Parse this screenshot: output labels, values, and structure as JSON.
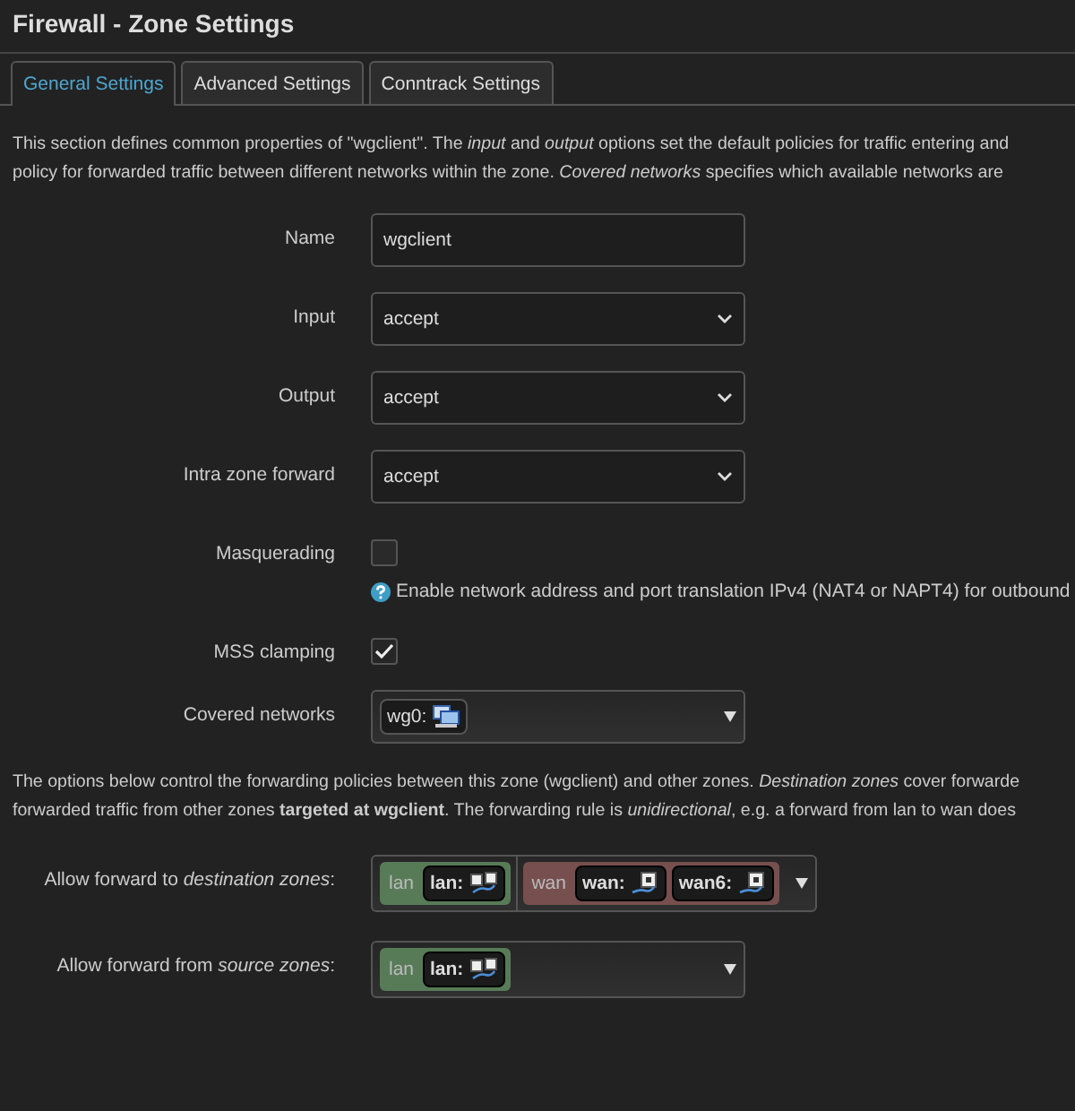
{
  "title": "Firewall - Zone Settings",
  "tabs": [
    {
      "label": "General Settings",
      "selected": true
    },
    {
      "label": "Advanced Settings",
      "selected": false
    },
    {
      "label": "Conntrack Settings",
      "selected": false
    }
  ],
  "intro": [
    "This section defines common properties of \"wgclient\". The *input* and *output* options set the default policies for traffic entering and",
    "policy for forwarded traffic between different networks within the zone. *Covered networks* specifies which available networks are"
  ],
  "fields": [
    {
      "kind": "text",
      "label": "Name",
      "value": "wgclient"
    },
    {
      "kind": "select",
      "label": "Input",
      "value": "accept"
    },
    {
      "kind": "select",
      "label": "Output",
      "value": "accept"
    },
    {
      "kind": "select",
      "label": "Intra zone forward",
      "value": "accept"
    },
    {
      "kind": "checkbox",
      "label": "Masquerading",
      "checked": false,
      "hint": "Enable network address and port translation IPv4 (NAT4 or NAPT4) for outbound"
    },
    {
      "kind": "checkbox",
      "label": "MSS clamping",
      "checked": true
    },
    {
      "kind": "networks",
      "label": "Covered networks",
      "networks": [
        {
          "name": "wg0:",
          "kind": "tunnel"
        }
      ]
    }
  ],
  "forwarding_intro": [
    "The options below control the forwarding policies between this zone (wgclient) and other zones. *Destination zones* cover forwarde",
    "forwarded traffic from other zones **targeted at wgclient**. The forwarding rule is *unidirectional*, e.g. a forward from lan to wan does"
  ],
  "forwarding": [
    {
      "label": "Allow forward to *destination zones*:",
      "zones": [
        {
          "name": "lan",
          "color": "#577a57",
          "networks": [
            {
              "name": "lan:",
              "kind": "bridge"
            }
          ]
        },
        {
          "name": "wan",
          "color": "#774f4f",
          "networks": [
            {
              "name": "wan:",
              "kind": "ethernet"
            },
            {
              "name": "wan6:",
              "kind": "ethernet"
            }
          ]
        }
      ]
    },
    {
      "label": "Allow forward from *source zones*:",
      "zones": [
        {
          "name": "lan",
          "color": "#577a57",
          "networks": [
            {
              "name": "lan:",
              "kind": "bridge"
            }
          ]
        }
      ]
    }
  ]
}
